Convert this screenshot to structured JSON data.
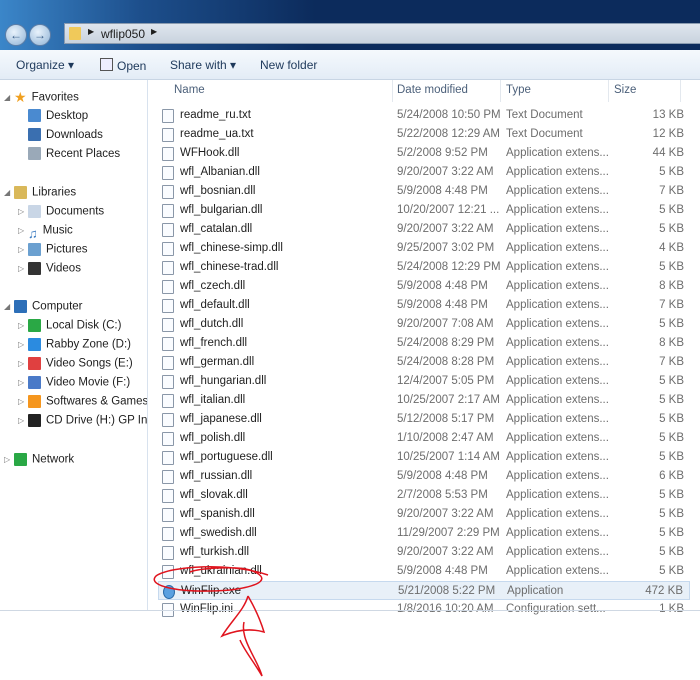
{
  "address": {
    "crumbs": [
      "wflip050"
    ]
  },
  "toolbar": {
    "organize": "Organize",
    "open": "Open",
    "share": "Share with",
    "new_folder": "New folder"
  },
  "sidebar": {
    "favorites": {
      "label": "Favorites",
      "items": [
        "Desktop",
        "Downloads",
        "Recent Places"
      ]
    },
    "libraries": {
      "label": "Libraries",
      "items": [
        "Documents",
        "Music",
        "Pictures",
        "Videos"
      ]
    },
    "computer": {
      "label": "Computer",
      "items": [
        "Local Disk (C:)",
        "Rabby Zone (D:)",
        "Video Songs (E:)",
        "Video Movie (F:)",
        "Softwares & Games",
        "CD Drive (H:) GP Inte"
      ]
    },
    "network": {
      "label": "Network"
    }
  },
  "columns": {
    "name": "Name",
    "date": "Date modified",
    "type": "Type",
    "size": "Size"
  },
  "files": [
    [
      "readme_ru.txt",
      "5/24/2008 10:50 PM",
      "Text Document",
      "13 KB"
    ],
    [
      "readme_ua.txt",
      "5/22/2008 12:29 AM",
      "Text Document",
      "12 KB"
    ],
    [
      "WFHook.dll",
      "5/2/2008 9:52 PM",
      "Application extens...",
      "44 KB"
    ],
    [
      "wfl_Albanian.dll",
      "9/20/2007 3:22 AM",
      "Application extens...",
      "5 KB"
    ],
    [
      "wfl_bosnian.dll",
      "5/9/2008 4:48 PM",
      "Application extens...",
      "7 KB"
    ],
    [
      "wfl_bulgarian.dll",
      "10/20/2007 12:21 ...",
      "Application extens...",
      "5 KB"
    ],
    [
      "wfl_catalan.dll",
      "9/20/2007 3:22 AM",
      "Application extens...",
      "5 KB"
    ],
    [
      "wfl_chinese-simp.dll",
      "9/25/2007 3:02 PM",
      "Application extens...",
      "4 KB"
    ],
    [
      "wfl_chinese-trad.dll",
      "5/24/2008 12:29 PM",
      "Application extens...",
      "5 KB"
    ],
    [
      "wfl_czech.dll",
      "5/9/2008 4:48 PM",
      "Application extens...",
      "8 KB"
    ],
    [
      "wfl_default.dll",
      "5/9/2008 4:48 PM",
      "Application extens...",
      "7 KB"
    ],
    [
      "wfl_dutch.dll",
      "9/20/2007 7:08 AM",
      "Application extens...",
      "5 KB"
    ],
    [
      "wfl_french.dll",
      "5/24/2008 8:29 PM",
      "Application extens...",
      "8 KB"
    ],
    [
      "wfl_german.dll",
      "5/24/2008 8:28 PM",
      "Application extens...",
      "7 KB"
    ],
    [
      "wfl_hungarian.dll",
      "12/4/2007 5:05 PM",
      "Application extens...",
      "5 KB"
    ],
    [
      "wfl_italian.dll",
      "10/25/2007 2:17 AM",
      "Application extens...",
      "5 KB"
    ],
    [
      "wfl_japanese.dll",
      "5/12/2008 5:17 PM",
      "Application extens...",
      "5 KB"
    ],
    [
      "wfl_polish.dll",
      "1/10/2008 2:47 AM",
      "Application extens...",
      "5 KB"
    ],
    [
      "wfl_portuguese.dll",
      "10/25/2007 1:14 AM",
      "Application extens...",
      "5 KB"
    ],
    [
      "wfl_russian.dll",
      "5/9/2008 4:48 PM",
      "Application extens...",
      "6 KB"
    ],
    [
      "wfl_slovak.dll",
      "2/7/2008 5:53 PM",
      "Application extens...",
      "5 KB"
    ],
    [
      "wfl_spanish.dll",
      "9/20/2007 3:22 AM",
      "Application extens...",
      "5 KB"
    ],
    [
      "wfl_swedish.dll",
      "11/29/2007 2:29 PM",
      "Application extens...",
      "5 KB"
    ],
    [
      "wfl_turkish.dll",
      "9/20/2007 3:22 AM",
      "Application extens...",
      "5 KB"
    ],
    [
      "wfl_ukrainian.dll",
      "5/9/2008 4:48 PM",
      "Application extens...",
      "5 KB"
    ],
    [
      "WinFlip.exe",
      "5/21/2008 5:22 PM",
      "Application",
      "472 KB"
    ],
    [
      "WinFlip.ini",
      "1/8/2016 10:20 AM",
      "Configuration sett...",
      "1 KB"
    ]
  ],
  "annotation_color": "#e0141e"
}
